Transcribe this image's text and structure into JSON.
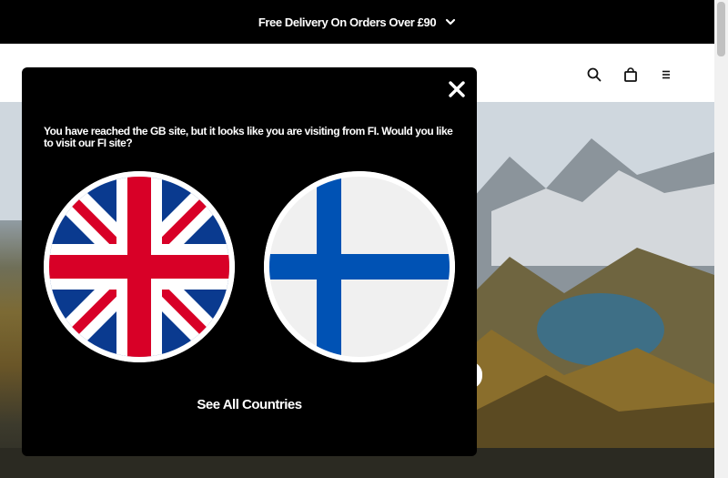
{
  "promo": {
    "text": "Free Delivery On Orders Over £90",
    "chevron_icon": "chevron-down-icon"
  },
  "header": {
    "icons": [
      "search-icon",
      "bag-icon",
      "menu-icon"
    ]
  },
  "modal": {
    "message": "You have reached the GB site, but it looks like you are visiting from FI. Would you like to visit our FI site?",
    "close_icon": "close-icon",
    "flags": [
      "uk-flag-icon",
      "finland-flag-icon"
    ],
    "see_all_label": "See All Countries"
  },
  "colors": {
    "black": "#000000",
    "white": "#ffffff",
    "uk_blue": "#0a3a8f",
    "uk_red": "#d80027",
    "fi_blue": "#0052b4"
  }
}
